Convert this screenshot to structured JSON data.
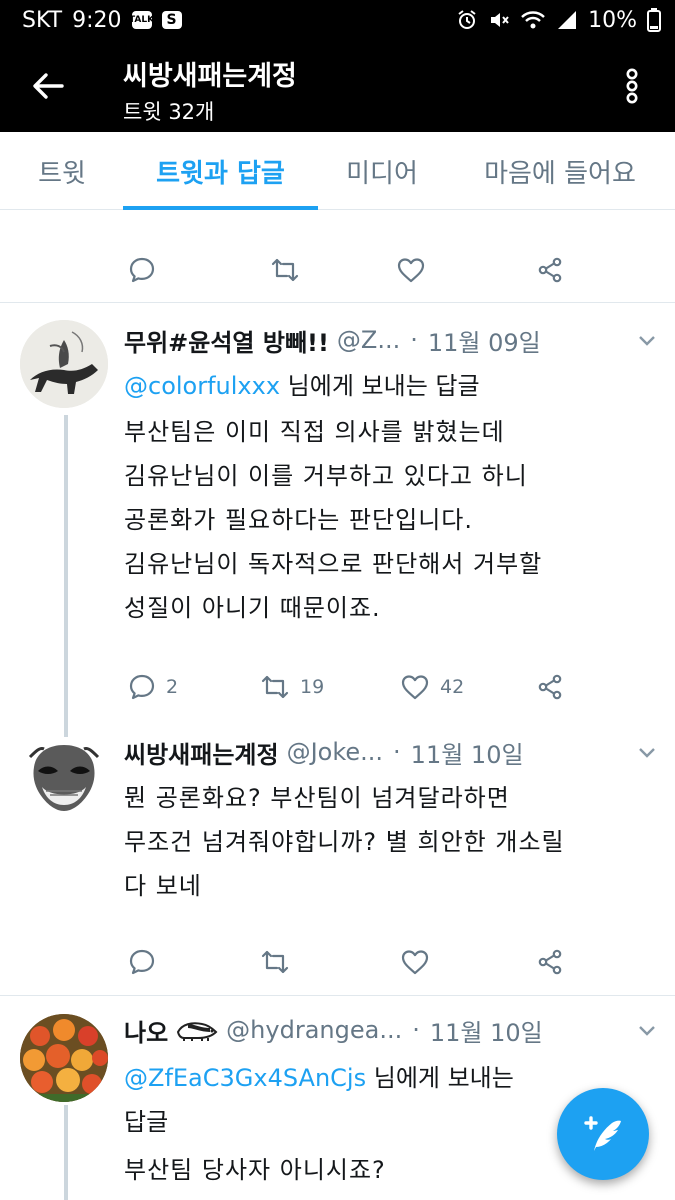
{
  "status_bar": {
    "carrier": "SKT",
    "time": "9:20",
    "talk_badge": "TALK",
    "s_badge": "S",
    "battery": "10%"
  },
  "header": {
    "account_name": "씨방새패는계정",
    "tweet_count": "트윗 32개"
  },
  "tabs": [
    {
      "label": "트윗",
      "active": false
    },
    {
      "label": "트윗과 답글",
      "active": true
    },
    {
      "label": "미디어",
      "active": false
    },
    {
      "label": "마음에 들어요",
      "active": false
    }
  ],
  "tweets": [
    {
      "name": "무위#윤석열 방빼!!",
      "handle": "@Z...",
      "date": "11월 09일",
      "reply_to_mention": "@colorfulxxx",
      "reply_to_suffix": " 님에게 보내는 답글",
      "lines": [
        "부산팀은 이미 직접 의사를 밝혔는데",
        "김유난님이 이를 거부하고 있다고 하니",
        "공론화가 필요하다는 판단입니다.",
        "김유난님이 독자적으로 판단해서 거부할",
        "성질이 아니기 때문이죠."
      ],
      "replies": "2",
      "retweets": "19",
      "likes": "42"
    },
    {
      "name": "씨방새패는계정",
      "handle": "@Joke...",
      "date": "11월 10일",
      "lines": [
        "뭔 공론화요? 부산팀이 넘겨달라하면",
        "무조건 넘겨줘야합니까? 별 희안한 개소릴",
        "다 보네"
      ]
    },
    {
      "name": "나오",
      "handle": "@hydrangea...",
      "date": "11월 10일",
      "reply_to_mention": "@ZfEaC3Gx4SAnCjs",
      "reply_to_suffix": " 님에게 보내는",
      "reply_to_line2": "답글",
      "lines": [
        "부산팀 당사자 아니시죠?"
      ]
    }
  ],
  "colors": {
    "accent": "#1da1f2",
    "muted": "#657786",
    "header_bg": "#000000"
  },
  "icons": [
    "back-arrow-icon",
    "overflow-menu-icon",
    "reply-icon",
    "retweet-icon",
    "like-icon",
    "share-icon",
    "chevron-down-icon",
    "compose-tweet-icon"
  ]
}
